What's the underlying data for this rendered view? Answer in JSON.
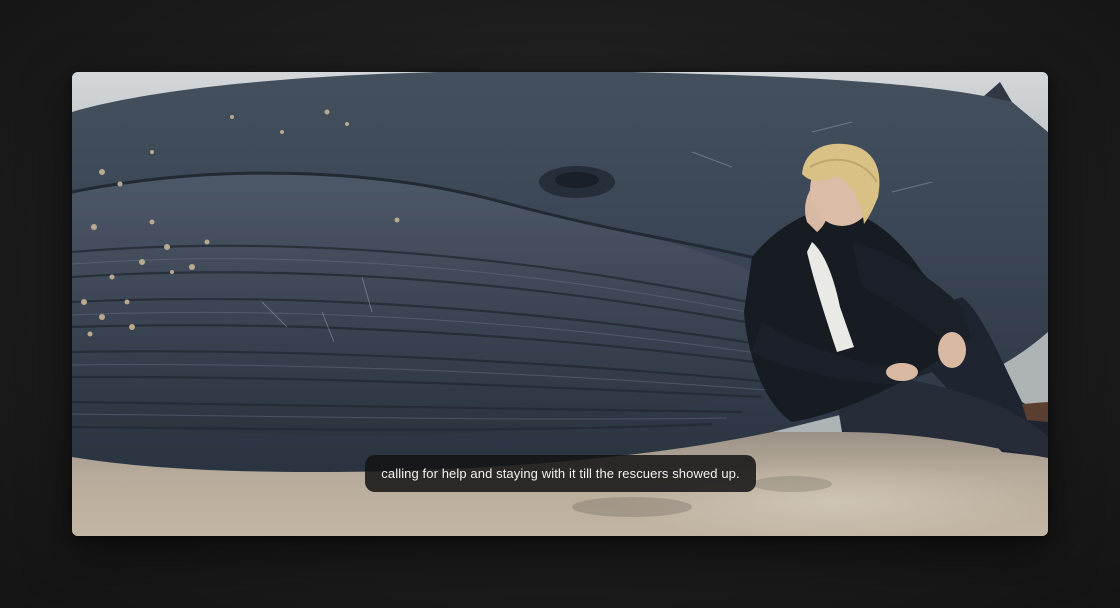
{
  "video": {
    "scene_description_icon": "stranded-whale-scene-icon"
  },
  "caption": {
    "text": "calling for help and staying with it till the rescuers showed up."
  },
  "colors": {
    "background": "#1d1d1d",
    "caption_bg": "#141414",
    "caption_text": "#f2f2f2",
    "whale_body": "#3b4656",
    "sand": "#b3a898",
    "sky": "#c9cdd0"
  }
}
